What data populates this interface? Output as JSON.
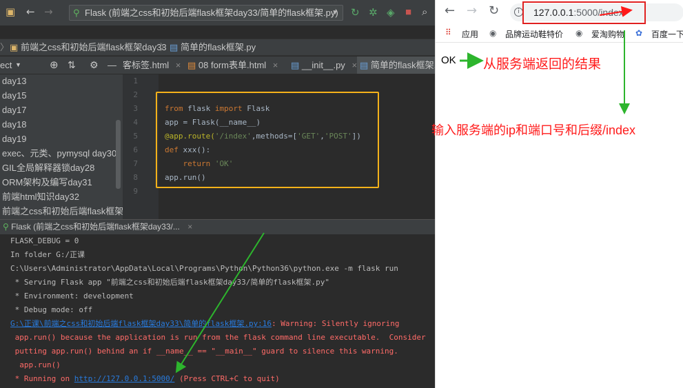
{
  "ide": {
    "run_config": "Flask (前端之css和初始后端flask框架day33/简单的flask框架.py)",
    "breadcrumb": {
      "folder": "前端之css和初始后端flask框架day33",
      "file": "简单的flask框架.py"
    },
    "project_label": "ect",
    "tabs": [
      {
        "label": "客标签.html"
      },
      {
        "label": "08 form表单.html"
      },
      {
        "label": "__init__.py"
      },
      {
        "label": "简单的flask框架.py"
      }
    ],
    "project_tree": [
      "day13",
      "day15",
      "day17",
      "day18",
      "day19",
      "exec、元类、pymysql day30",
      "GIL全局解释器锁day28",
      "ORM架构及编写day31",
      "前端html知识day32",
      "前端之css和初始后端flask框架d"
    ],
    "line_numbers": [
      "1",
      "2",
      "3",
      "4",
      "5",
      "6",
      "7",
      "8",
      "9"
    ],
    "code": {
      "l3_from": "from",
      "l3_mod": " flask ",
      "l3_import": "import",
      "l3_name": " Flask",
      "l4": "app = Flask(__name__)",
      "l5_dec": "@app.route(",
      "l5_path": "'/index'",
      "l5_mid": ",methods=[",
      "l5_get": "'GET'",
      "l5_comma": ",",
      "l5_post": "'POST'",
      "l5_end": "])",
      "l6_def": "def",
      "l6_rest": " xxx():",
      "l7_return": "    return",
      "l7_ok": " 'OK'",
      "l8": "app.run()"
    },
    "run_tab": "Flask (前端之css和初始后端flask框架day33/...",
    "console": [
      "FLASK_DEBUG = 0",
      "In folder G:/正课",
      "C:\\Users\\Administrator\\AppData\\Local\\Programs\\Python\\Python36\\python.exe -m flask run",
      " * Serving Flask app \"前端之css和初始后端flask框架day33/简单的flask框架.py\"",
      " * Environment: development",
      " * Debug mode: off"
    ],
    "warning_link": "G:\\正课\\前端之css和初始后端flask框架day33\\简单的flask框架.py:16",
    "warning_text": ": Warning: Silently ignoring",
    "warning_lines": [
      " app.run() because the application is run from the flask command line executable.  Consider",
      " putting app.run() behind an if __name__ == \"__main__\" guard to silence this warning.",
      "  app.run()"
    ],
    "running_prefix": " * Running on ",
    "running_url": "http://127.0.0.1:5000/",
    "running_suffix": " (Press CTRL+C to quit)"
  },
  "browser": {
    "url_host": "127.0.0.1",
    "url_rest": ":5000/index",
    "bookmarks": [
      "应用",
      "品牌运动鞋特价",
      "爱淘购物",
      "百度一下"
    ],
    "page_body": "OK"
  },
  "annotations": {
    "result_note": "从服务端返回的结果",
    "input_note": "输入服务端的ip和端口号和后缀/index"
  },
  "colors": {
    "annotation_red": "#ff1a1a",
    "arrow_green": "#2db52d",
    "highlight_orange": "#f5b21a",
    "keyword_orange": "#cc7832",
    "string_green": "#6a8759",
    "console_error": "#ff6b68",
    "console_link": "#287bde"
  }
}
